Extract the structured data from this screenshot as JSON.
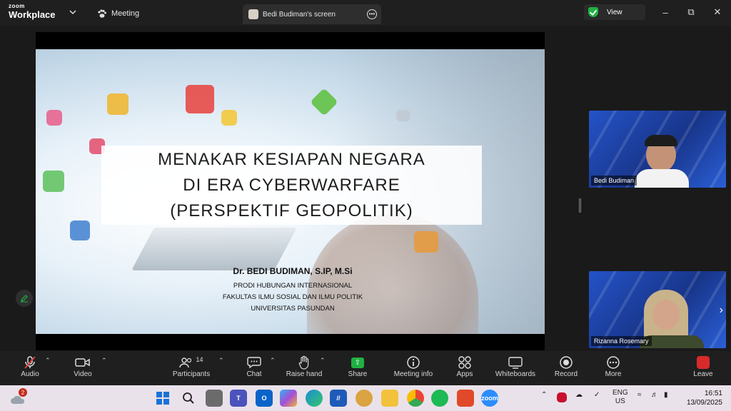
{
  "titlebar": {
    "logo_line1": "zoom",
    "logo_line2": "Workplace",
    "meeting_tab": "Meeting",
    "screen_tab": "Bedi Budiman's screen",
    "view_label": "View"
  },
  "slide": {
    "title_line1": "MENAKAR KESIAPAN NEGARA",
    "title_line2": "DI ERA CYBERWARFARE",
    "title_line3": "(PERSPEKTIF GEOPOLITIK)",
    "presenter_name": "Dr. BEDI BUDIMAN, S.IP, M.Si",
    "affiliation_1": "PRODI HUBUNGAN INTERNASIONAL",
    "affiliation_2": "FAKULTAS ILMU SOSIAL DAN ILMU POLITIK",
    "affiliation_3": "UNIVERSITAS PASUNDAN"
  },
  "participants_panel": {
    "tiles": [
      {
        "name": "Bedi Budiman"
      },
      {
        "name": "Rizanna Rosemary"
      }
    ]
  },
  "toolbar": {
    "audio": "Audio",
    "video": "Video",
    "participants": "Participants",
    "participants_count": "14",
    "chat": "Chat",
    "raise_hand": "Raise hand",
    "share": "Share",
    "meeting_info": "Meeting info",
    "apps": "Apps",
    "whiteboards": "Whiteboards",
    "record": "Record",
    "more": "More",
    "leave": "Leave"
  },
  "taskbar": {
    "weather_badge": "2",
    "lang_line1": "ENG",
    "lang_line2": "US",
    "time": "16:51",
    "date": "13/09/2025"
  },
  "colors": {
    "share_green": "#1fb141",
    "leave_red": "#d92a2a",
    "tile_blue": "#2453c7"
  }
}
